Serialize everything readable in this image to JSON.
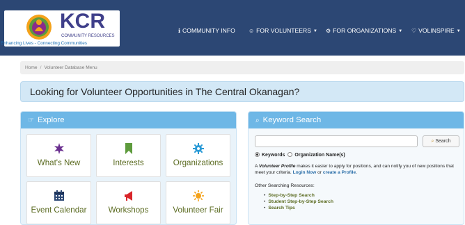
{
  "header": {
    "logo": {
      "title": "KCR",
      "subtitle": "COMMUNITY RESOURCES",
      "tagline": "Enhancing Lives - Connecting Communities"
    },
    "nav": [
      {
        "label": "COMMUNITY INFO",
        "icon": "info-circle-icon"
      },
      {
        "label": "FOR VOLUNTEERS",
        "icon": "person-icon"
      },
      {
        "label": "FOR ORGANIZATIONS",
        "icon": "gear-icon"
      },
      {
        "label": "VOLINSPIRE",
        "icon": "heart-icon"
      }
    ]
  },
  "breadcrumb": {
    "home": "Home",
    "separator": "/",
    "current": "Volunteer Database Menu"
  },
  "banner": {
    "text": "Looking for Volunteer Opportunities in The Central Okanagan?"
  },
  "explore": {
    "title": "Explore",
    "tiles": [
      {
        "label": "What's New",
        "icon": "starburst-icon"
      },
      {
        "label": "Interests",
        "icon": "bookmark-icon"
      },
      {
        "label": "Organizations",
        "icon": "gear-icon"
      },
      {
        "label": "Event Calendar",
        "icon": "calendar-icon"
      },
      {
        "label": "Workshops",
        "icon": "megaphone-icon"
      },
      {
        "label": "Volunteer Fair",
        "icon": "sun-icon"
      }
    ]
  },
  "keyword_search": {
    "title": "Keyword Search",
    "input_value": "",
    "button_label": "Search",
    "options": [
      {
        "label": "Keywords",
        "selected": true
      },
      {
        "label": "Organization Name(s)",
        "selected": false
      }
    ],
    "description": {
      "prefix": "A ",
      "profile_term": "Volunteer Profile",
      "middle": " makes it easier to apply for positions, and can notify you of new positions that meet your criteria. ",
      "login_link": "Login Now",
      "or": " or ",
      "create_link": "create a Profile",
      "suffix": "."
    },
    "other_heading": "Other Searching Resources:",
    "resources": [
      "Step-by-Step Search",
      "Student Step-by-Step Search",
      "Search Tips"
    ]
  },
  "colors": {
    "header_bg": "#2c4774",
    "panel_header": "#6eb7e6",
    "banner_bg": "#d3e8f6",
    "tile_label": "#5b6b21",
    "icon_purple": "#6a2f8f",
    "icon_green": "#5e9b3d",
    "icon_blue": "#2a9ad6",
    "icon_red": "#d9252a",
    "icon_orange": "#f4a21a"
  }
}
